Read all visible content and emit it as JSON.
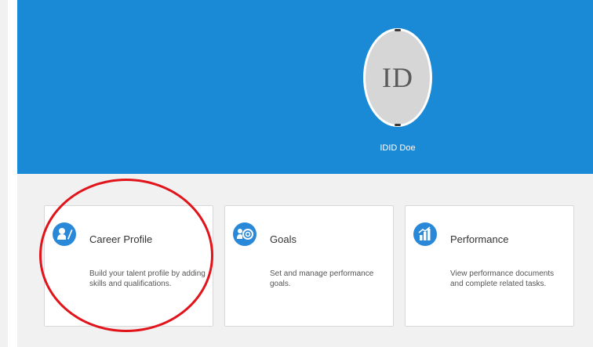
{
  "profile": {
    "initials": "ID",
    "name": "IDID Doe"
  },
  "cards": [
    {
      "title": "Career Profile",
      "description": "Build your talent profile by adding skills and qualifications.",
      "icon": "career-profile-icon"
    },
    {
      "title": "Goals",
      "description": "Set and manage performance goals.",
      "icon": "goals-icon"
    },
    {
      "title": "Performance",
      "description": "View performance documents and complete related tasks.",
      "icon": "performance-icon"
    }
  ],
  "colors": {
    "header": "#1a8ad6",
    "icon": "#2a88d8",
    "annotation": "#e1141b"
  }
}
